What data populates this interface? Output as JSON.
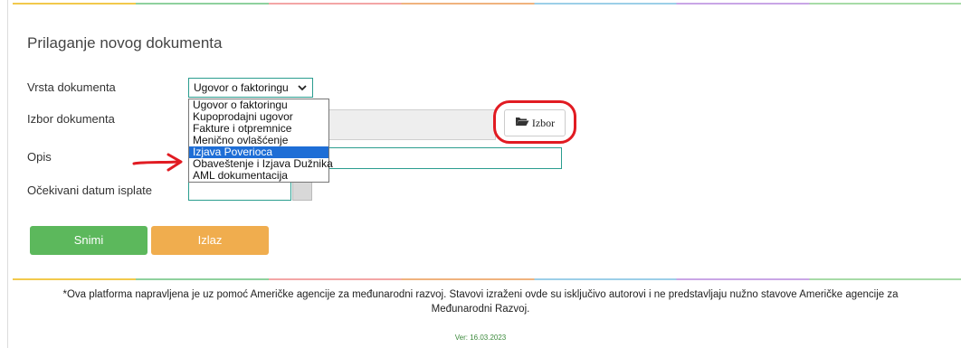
{
  "form": {
    "title": "Prilaganje novog dokumenta",
    "labels": {
      "doc_type": "Vrsta dokumenta",
      "doc_choice": "Izbor dokumenta",
      "description": "Opis",
      "expected_date": "Očekivani datum isplate"
    },
    "doc_type_select": {
      "selected": "Ugovor o faktoringu",
      "options": [
        "Ugovor o faktoringu",
        "Kupoprodajni ugovor",
        "Fakture i otpremnice",
        "Menično ovlašćenje",
        "Izjava Poverioca",
        "Obaveštenje i Izjava Dužnika",
        "AML dokumentacija"
      ],
      "highlighted_option": "Izjava Poverioca"
    },
    "file_field_value": "",
    "choose_button_label": "Izbor",
    "description_value": "",
    "expected_date_value": ""
  },
  "actions": {
    "save_label": "Snimi",
    "exit_label": "Izlaz"
  },
  "footer": {
    "disclaimer": "*Ova platforma napravljena je uz pomoć Američke agencije za međunarodni razvoj. Stavovi izraženi ovde su isključivo autorovi i ne predstavljaju nužno stavove Američke agencije za Međunarodni Razvoj.",
    "version": "Ver: 16.03.2023"
  },
  "annotations": {
    "arrow_color": "#e11b22",
    "circle_color": "#e11b22"
  },
  "colors": {
    "field_border": "#2a9d8f",
    "save_button": "#5cb85c",
    "exit_button": "#f0ad4e",
    "highlight": "#1e6ed6",
    "version_text": "#3c8a3c"
  },
  "icons": {
    "choose_button_icon": "folder-open-icon",
    "select_chevron": "chevron-down-icon",
    "calendar_button_icon": "calendar-icon"
  }
}
